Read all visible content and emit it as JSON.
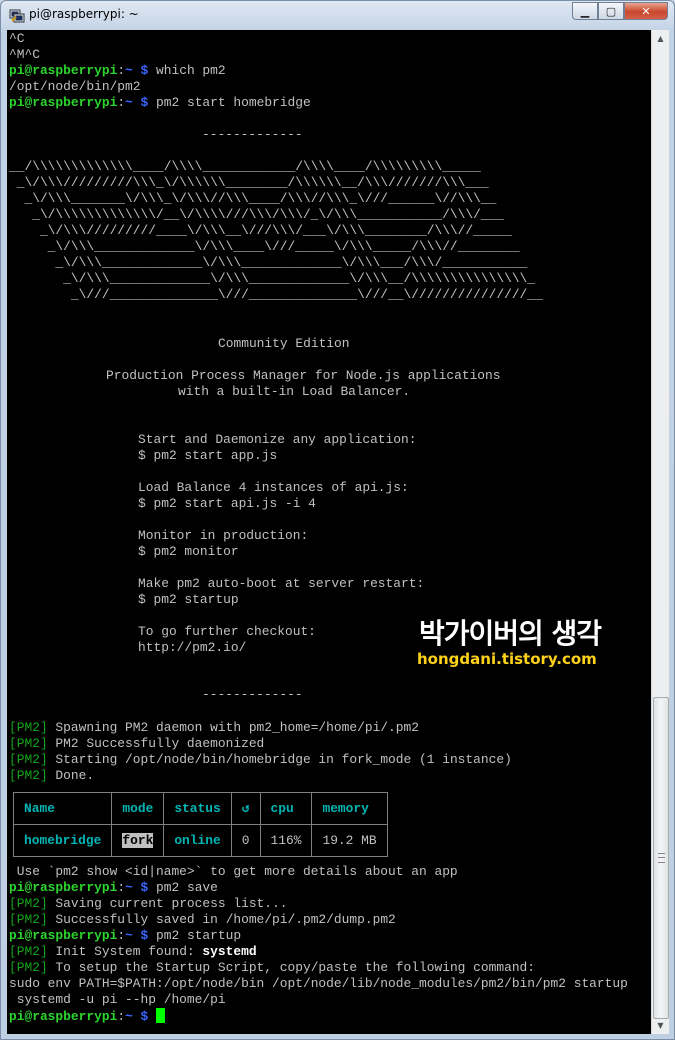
{
  "window": {
    "title": "pi@raspberrypi: ~",
    "icon": "putty-terminal-icon",
    "controls": {
      "minimize": "▁",
      "maximize": "▢",
      "close": "✕"
    }
  },
  "terminal": {
    "lines": {
      "l0": "^C",
      "l1": "^M^C",
      "prompt_user": "pi@raspberrypi",
      "prompt_sep": ":",
      "prompt_path": "~ $",
      "cmd_which": " which pm2",
      "out_which": "/opt/node/bin/pm2",
      "cmd_start": " pm2 start homebridge",
      "divider": "-------------",
      "ascii1": "__/\\\\\\\\\\\\\\\\\\\\\\\\\\____/\\\\\\\\____________/\\\\\\\\____/\\\\\\\\\\\\\\\\\\_____",
      "ascii2": " _\\/\\\\\\/////////\\\\\\_\\/\\\\\\\\\\\\________/\\\\\\\\\\\\__/\\\\\\///////\\\\\\___",
      "ascii3": "  _\\/\\\\\\_______\\/\\\\\\_\\/\\\\\\//\\\\\\____/\\\\\\//\\\\\\_\\///______\\//\\\\\\__",
      "ascii4": "   _\\/\\\\\\\\\\\\\\\\\\\\\\\\\\/__\\/\\\\\\\\///\\\\\\/\\\\\\/_\\/\\\\\\___________/\\\\\\/___",
      "ascii5": "    _\\/\\\\\\/////////____\\/\\\\\\__\\///\\\\\\/___\\/\\\\\\________/\\\\\\//_____",
      "ascii6": "     _\\/\\\\\\_____________\\/\\\\\\____\\///_____\\/\\\\\\_____/\\\\\\//________",
      "ascii7": "      _\\/\\\\\\_____________\\/\\\\\\_____________\\/\\\\\\___/\\\\\\/___________",
      "ascii8": "       _\\/\\\\\\_____________\\/\\\\\\_____________\\/\\\\\\__/\\\\\\\\\\\\\\\\\\\\\\\\\\\\\\_",
      "ascii9": "        _\\///______________\\///______________\\///__\\///////////////__",
      "community": "Community Edition",
      "ppm1": "Production Process Manager for Node.js applications",
      "ppm2": "with a built-in Load Balancer.",
      "help1": "Start and Daemonize any application:",
      "help2": "$ pm2 start app.js",
      "help3": "Load Balance 4 instances of api.js:",
      "help4": "$ pm2 start api.js -i 4",
      "help5": "Monitor in production:",
      "help6": "$ pm2 monitor",
      "help7": "Make pm2 auto-boot at server restart:",
      "help8": "$ pm2 startup",
      "help9": "To go further checkout:",
      "help10": "http://pm2.io/",
      "tag": "[PM2]",
      "pm2_1": " Spawning PM2 daemon with pm2_home=/home/pi/.pm2",
      "pm2_2": " PM2 Successfully daemonized",
      "pm2_3": " Starting /opt/node/bin/homebridge in fork_mode (1 instance)",
      "pm2_4": " Done.",
      "use_hint": " Use `pm2 show <id|name>` to get more details about an app",
      "cmd_save": " pm2 save",
      "save1": " Saving current process list...",
      "save2": " Successfully saved in /home/pi/.pm2/dump.pm2",
      "cmd_startup": " pm2 startup",
      "init_label": " Init System found: ",
      "init_value": "systemd",
      "setup": " To setup the Startup Script, copy/paste the following command:",
      "sudo1": "sudo env PATH=$PATH:/opt/node/bin /opt/node/lib/node_modules/pm2/bin/pm2 startup",
      "sudo2": " systemd -u pi --hp /home/pi"
    },
    "table": {
      "headers": [
        "Name",
        "mode",
        "status",
        "↺",
        "cpu",
        "memory"
      ],
      "row": {
        "name": "homebridge",
        "mode": "fork",
        "status": "online",
        "restarts": "0",
        "cpu": "116%",
        "memory": "19.2 MB"
      }
    },
    "colors": {
      "prompt_user": "#2bd52b",
      "prompt_path": "#3a66ff",
      "pm2_tag": "#17a517",
      "cursor": "#00ff00"
    }
  },
  "watermark": {
    "main": "박가이버의 생각",
    "url": "hongdani.tistory.com"
  }
}
